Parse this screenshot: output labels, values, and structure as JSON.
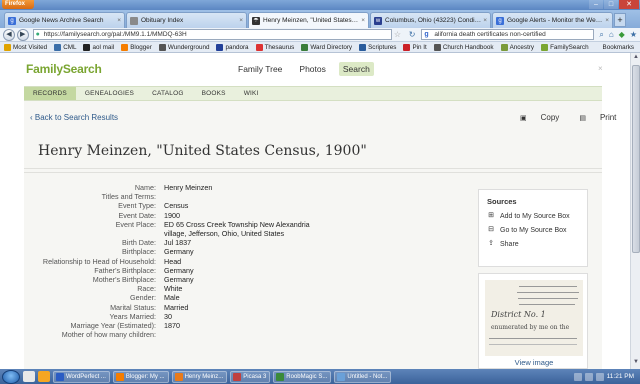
{
  "browser": {
    "menu_label": "Firefox",
    "window_controls": {
      "minimize": "–",
      "maximize": "□",
      "close": "✕"
    },
    "tabs": [
      {
        "label": "Google News Archive Search",
        "icon": "google-icon",
        "color": "#3a6fd8",
        "glyph": "g",
        "active": false
      },
      {
        "label": "Obituary Index",
        "icon": "page-icon",
        "color": "#8a8a8a",
        "glyph": "",
        "active": false
      },
      {
        "label": "Henry Meinzen, \"United States Cens...",
        "icon": "familysearch-icon",
        "color": "#333333",
        "glyph": "☂",
        "active": true
      },
      {
        "label": "Columbus, Ohio (43223) Conditions ...",
        "icon": "weather-icon",
        "color": "#2a3f8f",
        "glyph": "w",
        "active": false
      },
      {
        "label": "Google Alerts - Monitor the Web for ...",
        "icon": "google-icon",
        "color": "#3a6fd8",
        "glyph": "g",
        "active": false
      }
    ],
    "new_tab_label": "+",
    "tab_close": "×",
    "url": "https://familysearch.org/pal:/MM9.1.1/MMDQ-63H",
    "search_text": "alifornia death certificates non-certified",
    "search_engine": "g",
    "bookmarks": [
      {
        "label": "Most Visited",
        "icon": "star-icon",
        "color": "#e0a300"
      },
      {
        "label": "CML",
        "icon": "cml-icon",
        "color": "#3b6ea8"
      },
      {
        "label": "aol mail",
        "icon": "aol-icon",
        "color": "#222222"
      },
      {
        "label": "Blogger",
        "icon": "blogger-icon",
        "color": "#f57d00"
      },
      {
        "label": "Wunderground",
        "icon": "wunderground-icon",
        "color": "#555555"
      },
      {
        "label": "pandora",
        "icon": "pandora-icon",
        "color": "#224099"
      },
      {
        "label": "Thesaurus",
        "icon": "thesaurus-icon",
        "color": "#d33"
      },
      {
        "label": "Ward Directory",
        "icon": "directory-icon",
        "color": "#3a7d3a"
      },
      {
        "label": "Scriptures",
        "icon": "scriptures-icon",
        "color": "#2a5c9c"
      },
      {
        "label": "Pin It",
        "icon": "pinterest-icon",
        "color": "#cb2027"
      },
      {
        "label": "Church Handbook",
        "icon": "handbook-icon",
        "color": "#555555"
      },
      {
        "label": "Ancestry",
        "icon": "ancestry-icon",
        "color": "#7a9a3a"
      },
      {
        "label": "FamilySearch",
        "icon": "familysearch-icon",
        "color": "#7aa531"
      }
    ],
    "bookmarks_menu": "Bookmarks"
  },
  "site": {
    "logo": "FamilySearch",
    "nav": [
      "Family Tree",
      "Photos",
      "Search"
    ],
    "nav_active": "Search",
    "close": "×",
    "subnav": [
      "RECORDS",
      "GENEALOGIES",
      "CATALOG",
      "BOOKS",
      "WIKI"
    ],
    "subnav_active": "RECORDS"
  },
  "record": {
    "back_link": "Back to Search Results",
    "copy_label": "Copy",
    "print_label": "Print",
    "title": "Henry Meinzen, \"United States Census, 1900\"",
    "facts": [
      {
        "label": "Name:",
        "value": "Henry Meinzen"
      },
      {
        "label": "Titles and Terms:",
        "value": ""
      },
      {
        "label": "Event Type:",
        "value": "Census"
      },
      {
        "label": "Event Date:",
        "value": "1900"
      },
      {
        "label": "Event Place:",
        "value": "ED 65 Cross Creek Township New Alexandria village, Jefferson, Ohio, United States"
      },
      {
        "label": "Birth Date:",
        "value": "Jul 1837"
      },
      {
        "label": "Birthplace:",
        "value": "Germany"
      },
      {
        "label": "Relationship to Head of Household:",
        "value": "Head"
      },
      {
        "label": "Father's Birthplace:",
        "value": "Germany"
      },
      {
        "label": "Mother's Birthplace:",
        "value": "Germany"
      },
      {
        "label": "Race:",
        "value": "White"
      },
      {
        "label": "Gender:",
        "value": "Male"
      },
      {
        "label": "Marital Status:",
        "value": "Married"
      },
      {
        "label": "Years Married:",
        "value": "30"
      },
      {
        "label": "Marriage Year (Estimated):",
        "value": "1870"
      },
      {
        "label": "Mother of how many children:",
        "value": ""
      }
    ]
  },
  "sources": {
    "heading": "Sources",
    "items": [
      {
        "label": "Add to My Source Box",
        "icon": "add-box-icon"
      },
      {
        "label": "Go to My Source Box",
        "icon": "source-box-icon"
      },
      {
        "label": "Share",
        "icon": "share-icon"
      }
    ],
    "view_image": "View image",
    "thumb_text": [
      "District No. 1",
      "enumerated by me on the"
    ]
  },
  "taskbar": {
    "tasks": [
      {
        "label": "WordPerfect ...",
        "color": "#2a5cc4"
      },
      {
        "label": "Blogger: My ...",
        "color": "#f57d00"
      },
      {
        "label": "Henry Meinz...",
        "color": "#e87a1a"
      },
      {
        "label": "Picasa 3",
        "color": "#c04040"
      },
      {
        "label": "RoobMagic S...",
        "color": "#3a8a3a"
      },
      {
        "label": "Untitled - Not...",
        "color": "#6aa0d8"
      }
    ],
    "clock": "11:21 PM"
  }
}
